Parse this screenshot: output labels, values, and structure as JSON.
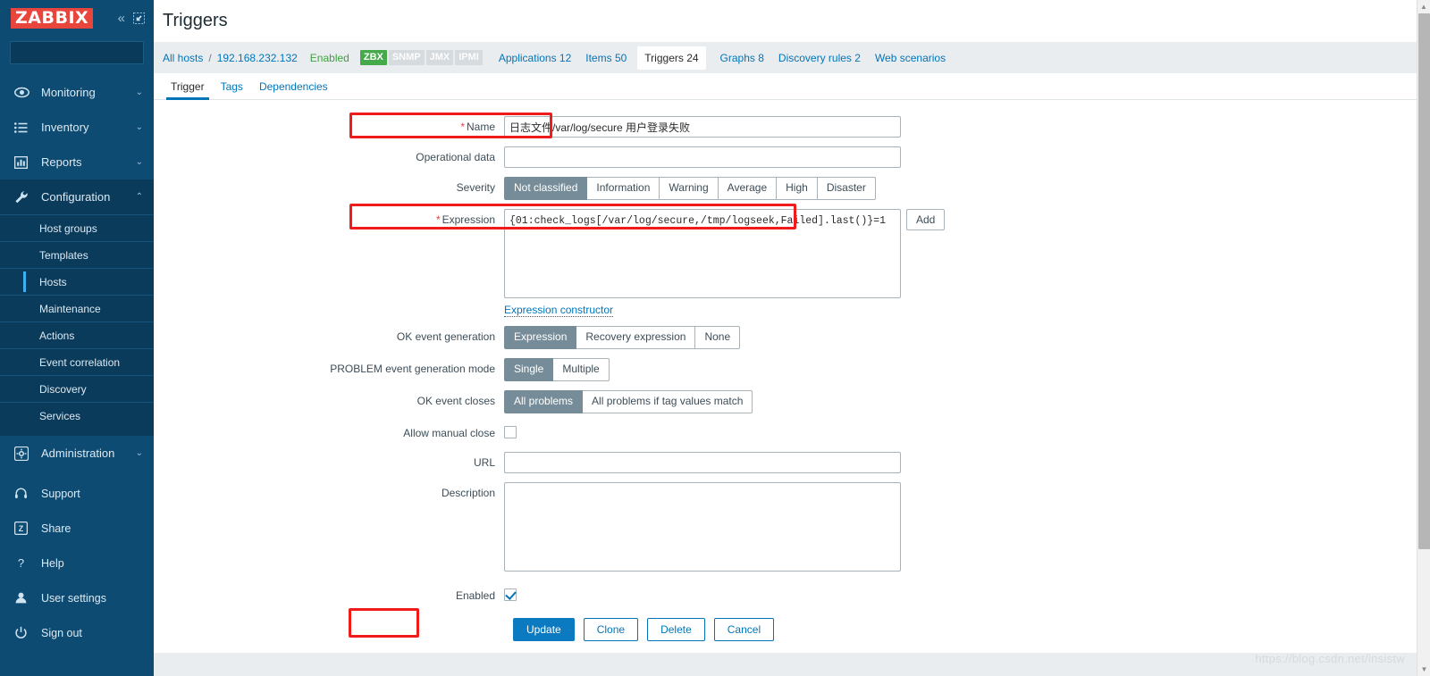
{
  "sidebar": {
    "logo": "ZABBIX",
    "collapse_icon": "«",
    "expand_icon": "expand-icon",
    "search": {
      "value": "",
      "placeholder": ""
    },
    "nav": [
      {
        "label": "Monitoring",
        "icon": "eye-icon",
        "caret": "⌄"
      },
      {
        "label": "Inventory",
        "icon": "list-icon",
        "caret": "⌄"
      },
      {
        "label": "Reports",
        "icon": "bar-chart-icon",
        "caret": "⌄"
      },
      {
        "label": "Configuration",
        "icon": "wrench-icon",
        "caret": "⌃"
      }
    ],
    "subnav": [
      {
        "label": "Host groups"
      },
      {
        "label": "Templates"
      },
      {
        "label": "Hosts"
      },
      {
        "label": "Maintenance"
      },
      {
        "label": "Actions"
      },
      {
        "label": "Event correlation"
      },
      {
        "label": "Discovery"
      },
      {
        "label": "Services"
      }
    ],
    "subnav_selected": "Hosts",
    "administration": {
      "label": "Administration",
      "icon": "gear-icon",
      "caret": "⌄"
    },
    "lower": [
      {
        "label": "Support",
        "icon": "headset-icon"
      },
      {
        "label": "Share",
        "icon": "zabbix-z-icon"
      },
      {
        "label": "Help",
        "icon": "question-icon"
      },
      {
        "label": "User settings",
        "icon": "user-icon"
      },
      {
        "label": "Sign out",
        "icon": "power-icon"
      }
    ]
  },
  "header": {
    "title": "Triggers"
  },
  "breadcrumb": {
    "all_hosts": "All hosts",
    "separator": "/",
    "host": "192.168.232.132",
    "status": "Enabled",
    "badges": [
      {
        "label": "ZBX",
        "active": true
      },
      {
        "label": "SNMP",
        "active": false
      },
      {
        "label": "JMX",
        "active": false
      },
      {
        "label": "IPMI",
        "active": false
      }
    ],
    "items": [
      {
        "label": "Applications 12",
        "current": false
      },
      {
        "label": "Items 50",
        "current": false
      },
      {
        "label": "Triggers 24",
        "current": true
      },
      {
        "label": "Graphs 8",
        "current": false
      },
      {
        "label": "Discovery rules 2",
        "current": false
      },
      {
        "label": "Web scenarios",
        "current": false
      }
    ]
  },
  "tabs": [
    {
      "label": "Trigger",
      "active": true
    },
    {
      "label": "Tags",
      "active": false
    },
    {
      "label": "Dependencies",
      "active": false
    }
  ],
  "form": {
    "name": {
      "label": "Name",
      "required": true,
      "value": "日志文件/var/log/secure 用户登录失败",
      "placeholder": ""
    },
    "operational_data": {
      "label": "Operational data",
      "value": "",
      "placeholder": ""
    },
    "severity": {
      "label": "Severity",
      "options": [
        "Not classified",
        "Information",
        "Warning",
        "Average",
        "High",
        "Disaster"
      ],
      "selected": "Not classified"
    },
    "expression": {
      "label": "Expression",
      "required": true,
      "value": "{01:check_logs[/var/log/secure,/tmp/logseek,Failed].last()}=1",
      "add_button": "Add",
      "constructor_link": "Expression constructor"
    },
    "ok_event_generation": {
      "label": "OK event generation",
      "options": [
        "Expression",
        "Recovery expression",
        "None"
      ],
      "selected": "Expression"
    },
    "problem_event_generation_mode": {
      "label": "PROBLEM event generation mode",
      "options": [
        "Single",
        "Multiple"
      ],
      "selected": "Single"
    },
    "ok_event_closes": {
      "label": "OK event closes",
      "options": [
        "All problems",
        "All problems if tag values match"
      ],
      "selected": "All problems"
    },
    "allow_manual_close": {
      "label": "Allow manual close",
      "checked": false
    },
    "url": {
      "label": "URL",
      "value": "",
      "placeholder": ""
    },
    "description": {
      "label": "Description",
      "value": "",
      "placeholder": ""
    },
    "enabled": {
      "label": "Enabled",
      "checked": true
    }
  },
  "buttons": {
    "update": "Update",
    "clone": "Clone",
    "delete": "Delete",
    "cancel": "Cancel"
  },
  "watermark": "https://blog.csdn.net/insistw",
  "colors": {
    "sidebar_bg": "#0e4b72",
    "logo_red": "#e8453c",
    "accent_blue": "#0275b8",
    "primary_button": "#0c7ac0",
    "selected_grey": "#768d99",
    "badge_green": "#45ab4a",
    "annotation_red": "#f01c1c",
    "enabled_green": "#3fa142"
  }
}
